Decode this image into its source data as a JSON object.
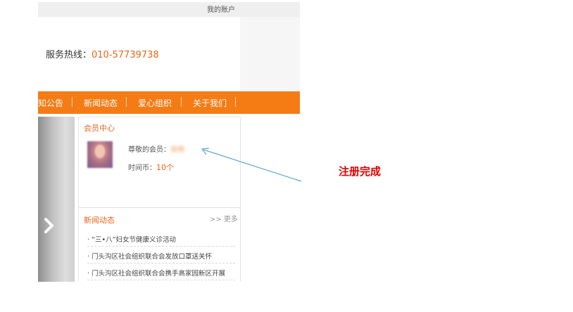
{
  "topbar": {
    "account_link": "我的账户"
  },
  "header": {
    "hotline_label": "服务热线：",
    "hotline_number": "010-57739738"
  },
  "nav": {
    "items": [
      "知公告",
      "新闻动态",
      "爱心组织",
      "关于我们"
    ]
  },
  "member_center": {
    "title": "会员中心",
    "greeting_label": "尊敬的会员：",
    "member_name": "张晓",
    "coin_label": "时间币：",
    "coin_value": "10个"
  },
  "news": {
    "title": "新闻动态",
    "more": ">> 更多",
    "items": [
      "· “三•八”妇女节健康义诊活动",
      "· 门头沟区社会组织联合会发放口罩送关怀",
      "· 门头沟区社会组织联合会携手高家园新区开展"
    ]
  },
  "annotation": {
    "text": "注册完成",
    "color": "#e00000",
    "arrow_color": "#5fa9c9"
  },
  "colors": {
    "nav_bg": "#f57b15",
    "accent": "#e8661c"
  },
  "icons": {
    "banner_arrow": "chevron-right-icon"
  }
}
